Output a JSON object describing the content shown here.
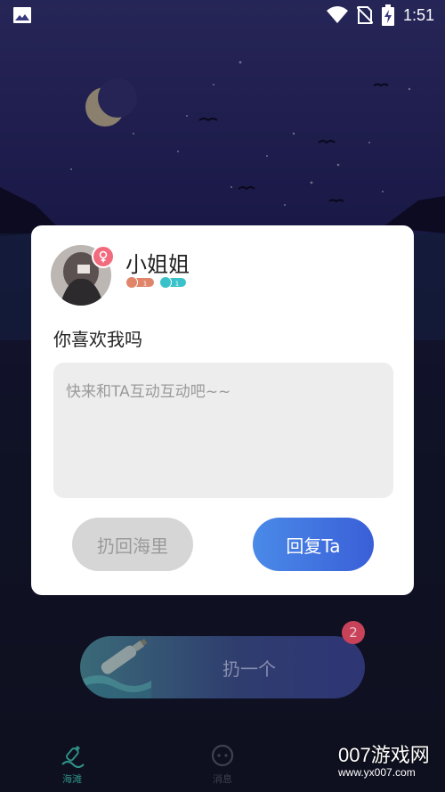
{
  "status_bar": {
    "time": "1:51",
    "icons": [
      "image-icon",
      "wifi-icon",
      "no-sim-icon",
      "battery-charging-icon"
    ]
  },
  "dialog": {
    "nickname": "小姐姐",
    "gender": "female",
    "level_badges": [
      "1",
      "1"
    ],
    "message": "你喜欢我吗",
    "reply_placeholder": "快来和TA互动互动吧~~",
    "reply_value": "",
    "throw_back_label": "扔回海里",
    "reply_label": "回复Ta"
  },
  "main": {
    "throw_label": "扔一个",
    "unread_count": "2"
  },
  "tabs": [
    {
      "label": "海滩",
      "icon": "beach-bottle-icon",
      "active": true
    },
    {
      "label": "消息",
      "icon": "message-icon",
      "active": false
    }
  ],
  "watermark": {
    "title": "007游戏网",
    "url": "www.yx007.com"
  },
  "colors": {
    "accent_blue": "#3a6fe0",
    "gender_pink": "#f26a7d",
    "tab_active": "#31c7b5",
    "badge_red": "#c8425a"
  }
}
